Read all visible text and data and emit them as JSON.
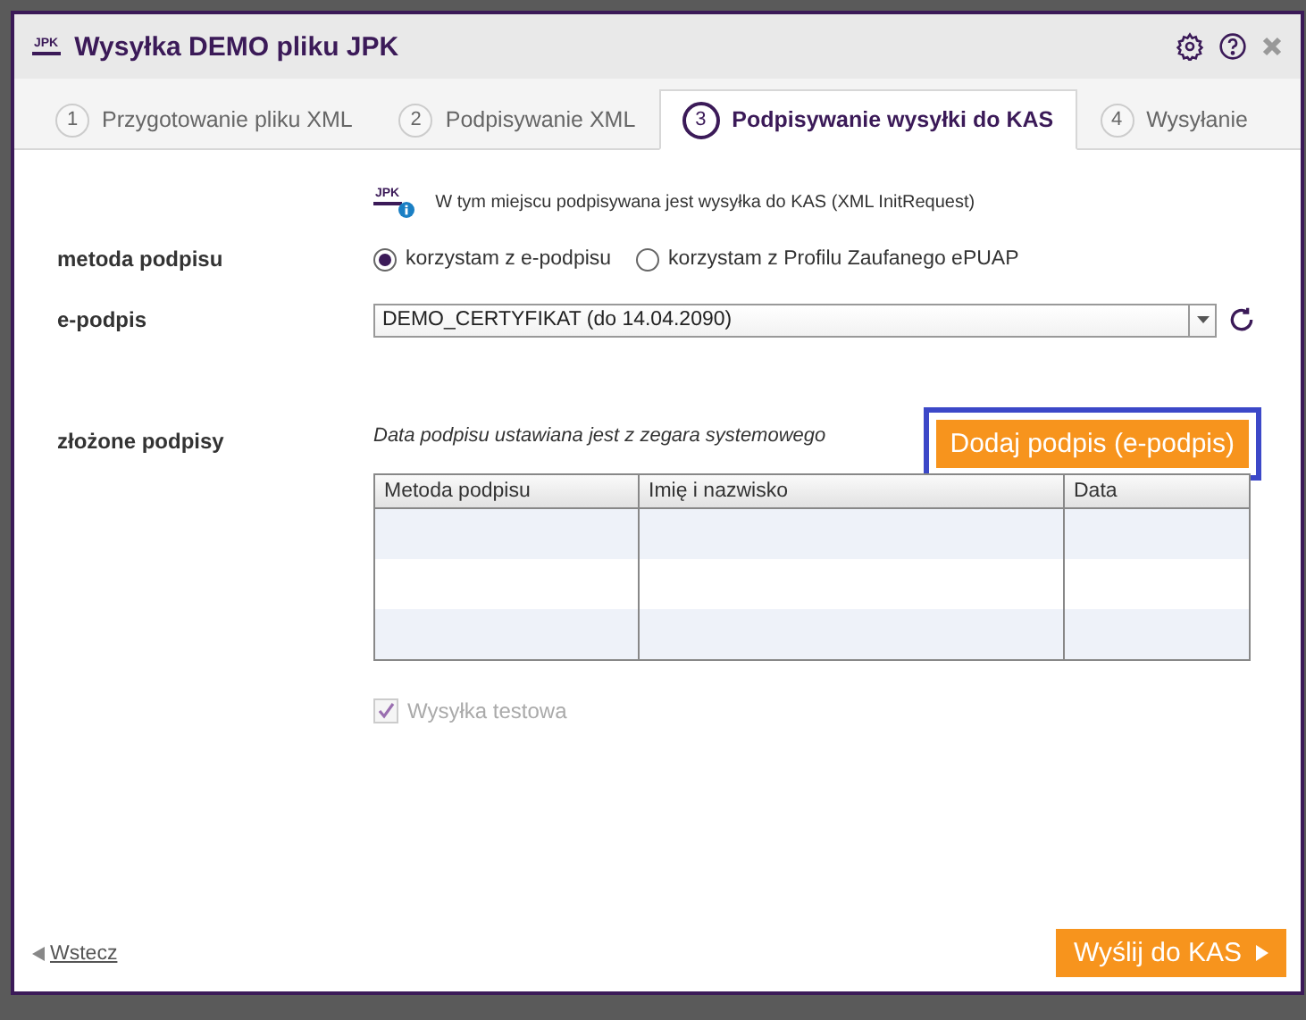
{
  "window": {
    "title": "Wysyłka DEMO pliku JPK",
    "logo_text": "JPK"
  },
  "tabs": [
    {
      "number": "1",
      "label": "Przygotowanie pliku XML",
      "selected": false
    },
    {
      "number": "2",
      "label": "Podpisywanie XML",
      "selected": false
    },
    {
      "number": "3",
      "label": "Podpisywanie wysyłki do KAS",
      "selected": true
    },
    {
      "number": "4",
      "label": "Wysyłanie",
      "selected": false
    }
  ],
  "info": {
    "logo_text": "JPK",
    "text": "W tym miejscu podpisywana jest wysyłka do KAS (XML InitRequest)"
  },
  "signature_method": {
    "label": "metoda podpisu",
    "options": [
      {
        "label": "korzystam z e-podpisu",
        "selected": true
      },
      {
        "label": "korzystam z Profilu Zaufanego ePUAP",
        "selected": false
      }
    ]
  },
  "e_signature": {
    "label": "e-podpis",
    "value": "DEMO_CERTYFIKAT (do 14.04.2090)"
  },
  "signatures": {
    "label": "złożone podpisy",
    "note": "Data podpisu ustawiana jest z zegara systemowego",
    "add_button": "Dodaj podpis (e-podpis)",
    "add_button_focused": true,
    "columns": [
      "Metoda podpisu",
      "Imię i nazwisko",
      "Data"
    ]
  },
  "test_send": {
    "label": "Wysyłka testowa",
    "checked": true,
    "disabled": true
  },
  "footer": {
    "back": "Wstecz",
    "send": "Wyślij do KAS"
  }
}
